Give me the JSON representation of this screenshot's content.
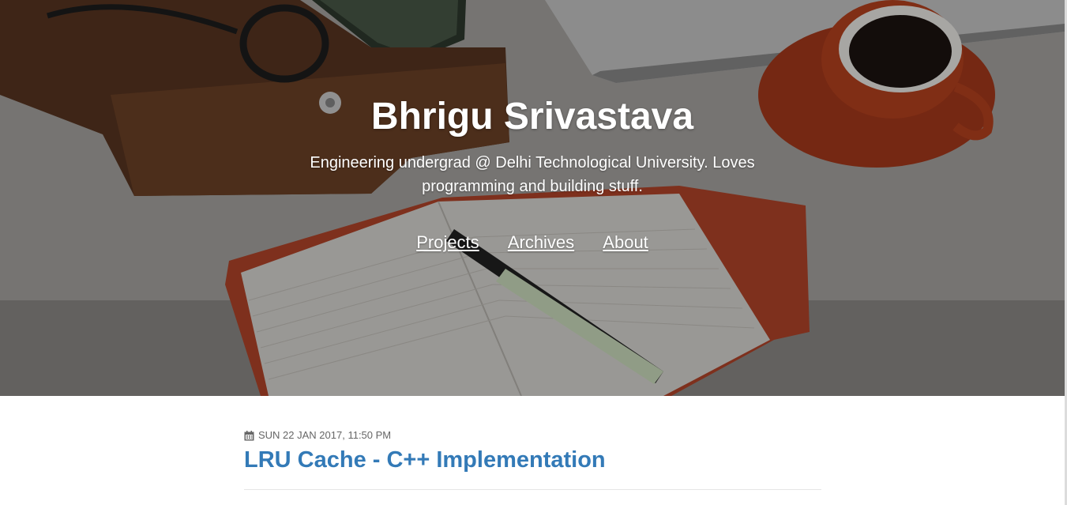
{
  "hero": {
    "title": "Bhrigu Srivastava",
    "description": "Engineering undergrad @ Delhi Technological University. Loves programming and building stuff.",
    "nav": [
      {
        "label": "Projects"
      },
      {
        "label": "Archives"
      },
      {
        "label": "About"
      }
    ]
  },
  "post": {
    "date": "SUN 22 JAN 2017, 11:50 PM",
    "date_icon": "calendar-icon",
    "title": "LRU Cache - C++ Implementation"
  },
  "colors": {
    "link": "#337ab7",
    "meta": "#666666",
    "hero_text": "#ffffff"
  }
}
